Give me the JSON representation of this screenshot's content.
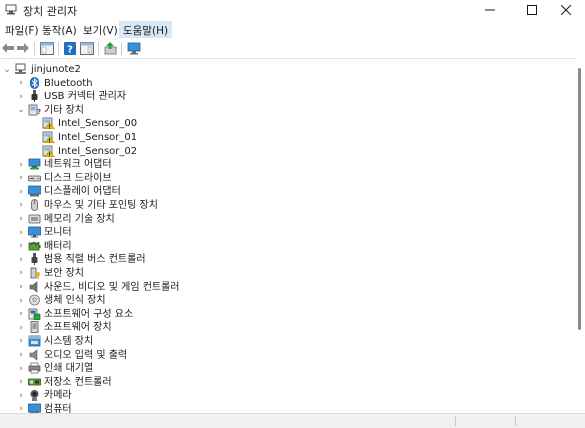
{
  "window": {
    "title": "장치 관리자",
    "controls": [
      "minimize-icon",
      "maximize-icon",
      "close-icon"
    ]
  },
  "menubar": {
    "items": [
      {
        "label": "파일(F)"
      },
      {
        "label": "동작(A)"
      },
      {
        "label": "보기(V)"
      },
      {
        "label": "도움말(H)",
        "active": true
      }
    ]
  },
  "toolbar": {
    "buttons": [
      "back-arrow-icon",
      "forward-arrow-icon",
      "properties-icon",
      "help-icon",
      "action-pane-icon",
      "update-driver-icon",
      "monitor-scan-icon"
    ]
  },
  "tree": {
    "root": "jinjunote2",
    "nodes": [
      {
        "label": "Bluetooth",
        "icon": "bluetooth-icon",
        "expanded": false
      },
      {
        "label": "USB 커넥터 관리자",
        "icon": "usb-connector-icon",
        "expanded": false
      },
      {
        "label": "기타 장치",
        "icon": "unknown-device-icon",
        "expanded": true
      },
      {
        "label": "Intel_Sensor_00",
        "icon": "warning-device-icon",
        "child": true
      },
      {
        "label": "Intel_Sensor_01",
        "icon": "warning-device-icon",
        "child": true
      },
      {
        "label": "Intel_Sensor_02",
        "icon": "warning-device-icon",
        "child": true
      },
      {
        "label": "네트워크 어댑터",
        "icon": "network-adapter-icon",
        "expanded": false
      },
      {
        "label": "디스크 드라이브",
        "icon": "disk-drive-icon",
        "expanded": false
      },
      {
        "label": "디스플레이 어댑터",
        "icon": "display-adapter-icon",
        "expanded": false
      },
      {
        "label": "마우스 및 기타 포인팅 장치",
        "icon": "mouse-icon",
        "expanded": false
      },
      {
        "label": "메모리 기술 장치",
        "icon": "memory-device-icon",
        "expanded": false
      },
      {
        "label": "모니터",
        "icon": "monitor-icon",
        "expanded": false
      },
      {
        "label": "배터리",
        "icon": "battery-icon",
        "expanded": false
      },
      {
        "label": "범용 직렬 버스 컨트롤러",
        "icon": "usb-controller-icon",
        "expanded": false
      },
      {
        "label": "보안 장치",
        "icon": "security-device-icon",
        "expanded": false
      },
      {
        "label": "사운드, 비디오 및 게임 컨트롤러",
        "icon": "sound-icon",
        "expanded": false
      },
      {
        "label": "생체 인식 장치",
        "icon": "biometric-icon",
        "expanded": false
      },
      {
        "label": "소프트웨어 구성 요소",
        "icon": "software-component-icon",
        "expanded": false
      },
      {
        "label": "소프트웨어 장치",
        "icon": "software-device-icon",
        "expanded": false
      },
      {
        "label": "시스템 장치",
        "icon": "system-device-icon",
        "expanded": false
      },
      {
        "label": "오디오 입력 및 출력",
        "icon": "audio-io-icon",
        "expanded": false
      },
      {
        "label": "인쇄 대기열",
        "icon": "print-queue-icon",
        "expanded": false
      },
      {
        "label": "저장소 컨트롤러",
        "icon": "storage-controller-icon",
        "expanded": false
      },
      {
        "label": "카메라",
        "icon": "camera-icon",
        "expanded": false
      },
      {
        "label": "컴퓨터",
        "icon": "computer-icon",
        "expanded": false
      }
    ]
  },
  "colors": {
    "menu_active_bg": "#d9e8f7",
    "warning": "#f2b705",
    "blue": "#1f6fc5"
  }
}
